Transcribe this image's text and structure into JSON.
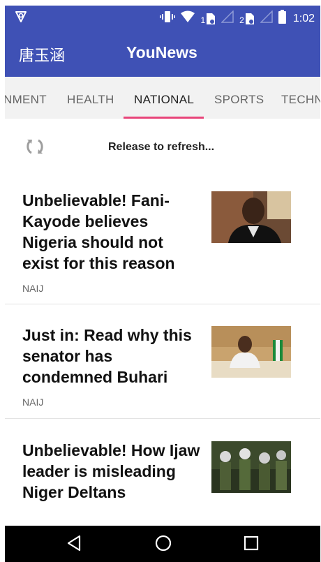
{
  "status_bar": {
    "time": "1:02",
    "sim1": "1",
    "sim2": "2",
    "icons": [
      "shield-icon",
      "vibrate-icon",
      "wifi-icon",
      "sim-icon",
      "signal-icon",
      "battery-icon"
    ]
  },
  "app_bar": {
    "user_name": "唐玉涵",
    "title": "YouNews"
  },
  "tabs": {
    "items": [
      "NMENT",
      "HEALTH",
      "NATIONAL",
      "SPORTS",
      "TECHN"
    ],
    "selected": "NATIONAL",
    "indicator_color": "#e8457a"
  },
  "refresh": {
    "text": "Release to refresh..."
  },
  "articles": [
    {
      "title": "Unbelievable! Fani-Kayode believes Nigeria should not exist for this reason",
      "source": "NAIJ"
    },
    {
      "title": "Just in: Read why this senator has condemned Buhari",
      "source": "NAIJ"
    },
    {
      "title": "Unbelievable! How Ijaw leader is misleading Niger Deltans",
      "source": ""
    }
  ],
  "nav_bar": {
    "icons": [
      "back-icon",
      "home-icon",
      "recents-icon"
    ]
  },
  "colors": {
    "primary": "#3f51b5",
    "accent": "#e8457a"
  }
}
